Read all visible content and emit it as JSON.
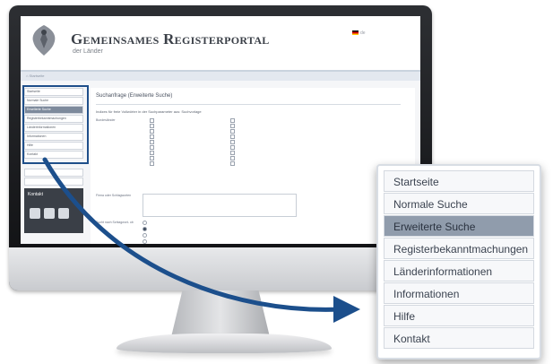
{
  "site": {
    "title": "Gemeinsames Registerportal",
    "subtitle": "der Länder",
    "language": "de"
  },
  "breadcrumb": "Startseite",
  "content": {
    "title": "Suchanfrage (Erweiterte Suche)",
    "hint": "Indizes für freie Vollwörter in der Suchparameter aus:  Suchvorlage",
    "label_states": "Bundesländer",
    "label_keywords": "Firma oder Schlagworten",
    "label_search": "Sucht nach Schlagwort- ob"
  },
  "side_nav": {
    "items": [
      "Startseite",
      "Normale Suche",
      "Erweiterte Suche",
      "Registerbekanntmachungen",
      "Länderinformationen",
      "Informationen",
      "Hilfe",
      "Kontakt"
    ],
    "active_index": 2
  },
  "kontakt_box": {
    "title": "Kontakt"
  },
  "zoom_menu": {
    "items": [
      "Startseite",
      "Normale Suche",
      "Erweiterte Suche",
      "Registerbekanntmachungen",
      "Länderinformationen",
      "Informationen",
      "Hilfe",
      "Kontakt"
    ],
    "active_index": 2
  },
  "colors": {
    "arrow": "#1c4f8c",
    "active_item": "#909cac"
  }
}
